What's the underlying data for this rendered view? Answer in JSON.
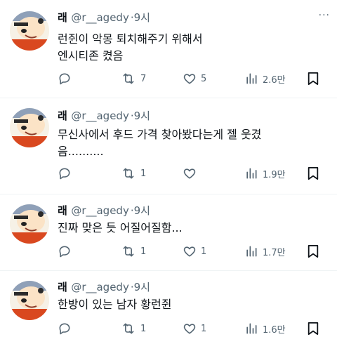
{
  "tweets": [
    {
      "name": "래",
      "handle": "@r__agedy",
      "time": "9시",
      "lines": [
        "런쥔이 악몽 퇴치해주기 위해서",
        "엔시티존 켰음"
      ],
      "replies": "",
      "retweets": "7",
      "likes": "5",
      "views": "2.6만"
    },
    {
      "name": "래",
      "handle": "@r__agedy",
      "time": "9시",
      "lines": [
        "무신사에서 후드 가격 찾아봤다는게 젤 웃겼",
        "음.........."
      ],
      "replies": "",
      "retweets": "1",
      "likes": "",
      "views": "1.9만"
    },
    {
      "name": "래",
      "handle": "@r__agedy",
      "time": "9시",
      "lines": [
        "진짜 맞은 듯 어질어질함..."
      ],
      "replies": "",
      "retweets": "1",
      "likes": "1",
      "views": "1.7만"
    },
    {
      "name": "래",
      "handle": "@r__agedy",
      "time": "9시",
      "lines": [
        "한방이 있는 남자 황런쥔"
      ],
      "replies": "",
      "retweets": "1",
      "likes": "1",
      "views": "1.6만"
    }
  ],
  "icons": {
    "reply": "reply-icon",
    "retweet": "retweet-icon",
    "like": "heart-icon",
    "views": "views-icon",
    "bookmark": "bookmark-icon",
    "more": "more-icon"
  },
  "colors": {
    "text": "#0f1419",
    "muted": "#536471",
    "divider": "#eff3f4"
  }
}
